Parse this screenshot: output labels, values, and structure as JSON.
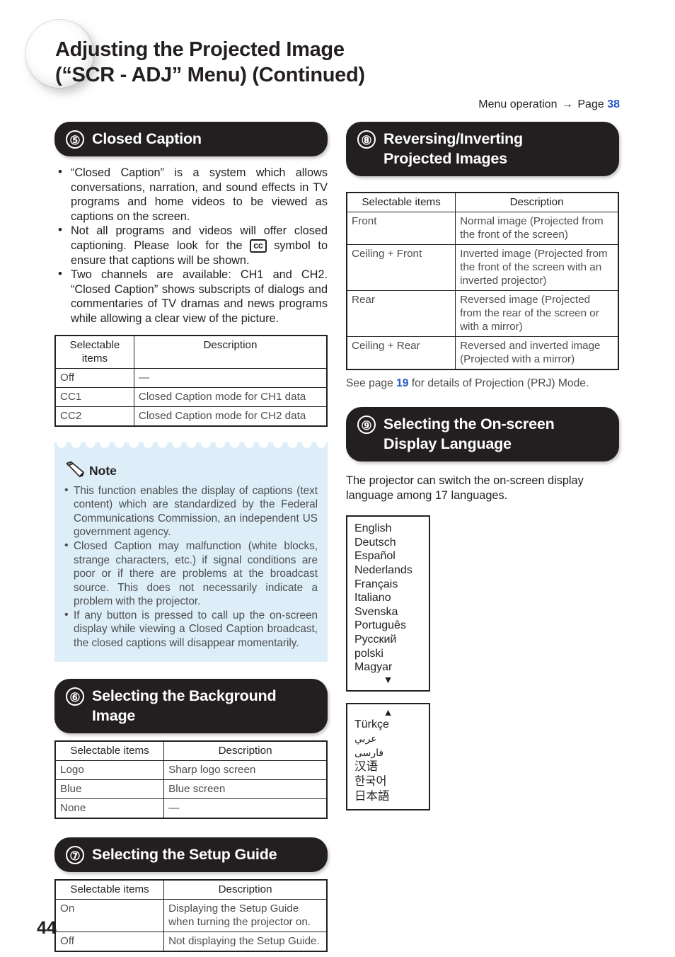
{
  "header": {
    "title_line1": "Adjusting the Projected Image",
    "title_line2": "(“SCR - ADJ” Menu) (Continued)",
    "menu_operation_label": "Menu operation",
    "menu_operation_arrow": "→",
    "menu_operation_page_word": "Page",
    "menu_operation_page_number": "38"
  },
  "colors": {
    "pill_background": "#231f20",
    "note_background": "#ddeef8",
    "link_blue": "#2a58c8",
    "body_text": "#231f20",
    "table_text": "#4d4d4f"
  },
  "table_headers": {
    "selectable_items": "Selectable items",
    "description": "Description"
  },
  "sections": {
    "closed_caption": {
      "number": "⑤",
      "title": "Closed Caption",
      "bullets": [
        {
          "text_before": "“Closed Caption” is a system which allows conversations, narration, and sound effects in TV programs and home videos to be viewed as captions on the screen."
        },
        {
          "text_before": "Not all programs and videos will offer closed captioning. Please look for the ",
          "inline_symbol": "cc",
          "text_after": " symbol to ensure that captions will be shown."
        },
        {
          "text_before": "Two channels are available: CH1 and CH2. “Closed Caption” shows subscripts of dialogs and commentaries of TV dramas and news programs while allowing a clear view of the picture."
        }
      ],
      "rows": [
        {
          "item": "Off",
          "desc": "—"
        },
        {
          "item": "CC1",
          "desc": "Closed Caption mode for CH1 data"
        },
        {
          "item": "CC2",
          "desc": "Closed Caption mode for CH2 data"
        }
      ]
    },
    "note": {
      "label": "Note",
      "items": [
        "This function enables the display of captions (text content) which are standardized by the Federal Communications Commission, an independent US government agency.",
        "Closed Caption may malfunction (white blocks, strange characters, etc.) if signal conditions are poor or if there are problems at the broadcast source. This does not necessarily indicate a problem with the projector.",
        "If any button is pressed to call up the on-screen display while viewing a Closed Caption broadcast, the closed captions will disappear momentarily."
      ]
    },
    "background_image": {
      "number": "⑥",
      "title_line1": "Selecting the Background",
      "title_line2": "Image",
      "rows": [
        {
          "item": "Logo",
          "desc": "Sharp logo screen"
        },
        {
          "item": "Blue",
          "desc": "Blue screen"
        },
        {
          "item": "None",
          "desc": "—"
        }
      ]
    },
    "setup_guide": {
      "number": "⑦",
      "title": "Selecting the Setup Guide",
      "rows": [
        {
          "item": "On",
          "desc": "Displaying the Setup Guide when turning the projector on."
        },
        {
          "item": "Off",
          "desc": "Not displaying the Setup Guide."
        }
      ]
    },
    "reversing_inverting": {
      "number": "⑧",
      "title_line1": "Reversing/Inverting",
      "title_line2": "Projected Images",
      "rows": [
        {
          "item": "Front",
          "desc": "Normal image (Projected from the front of the screen)"
        },
        {
          "item": "Ceiling + Front",
          "desc": "Inverted image (Projected from the front of the screen with an inverted projector)"
        },
        {
          "item": "Rear",
          "desc": "Reversed image (Projected from the rear of the screen or with a mirror)"
        },
        {
          "item": "Ceiling + Rear",
          "desc": "Reversed and inverted image (Projected with a mirror)"
        }
      ],
      "see_page_before": "See page ",
      "see_page_number": "19",
      "see_page_after": " for details of Projection (PRJ) Mode."
    },
    "display_language": {
      "number": "⑨",
      "title_line1": "Selecting the On-screen",
      "title_line2": "Display Language",
      "intro": "The projector can switch the on-screen display language among 17 languages.",
      "list_box_1": [
        "English",
        "Deutsch",
        "Español",
        "Nederlands",
        "Français",
        "Italiano",
        "Svenska",
        "Português",
        "Русский",
        "polski",
        "Magyar"
      ],
      "list_box_1_arrow": "▼",
      "list_box_2_arrow": "▲",
      "list_box_2": [
        "Türkçe",
        "عربي",
        "فارسى",
        "汉语",
        "한국어",
        "日本語"
      ]
    }
  },
  "footer": {
    "page_number": "44"
  }
}
